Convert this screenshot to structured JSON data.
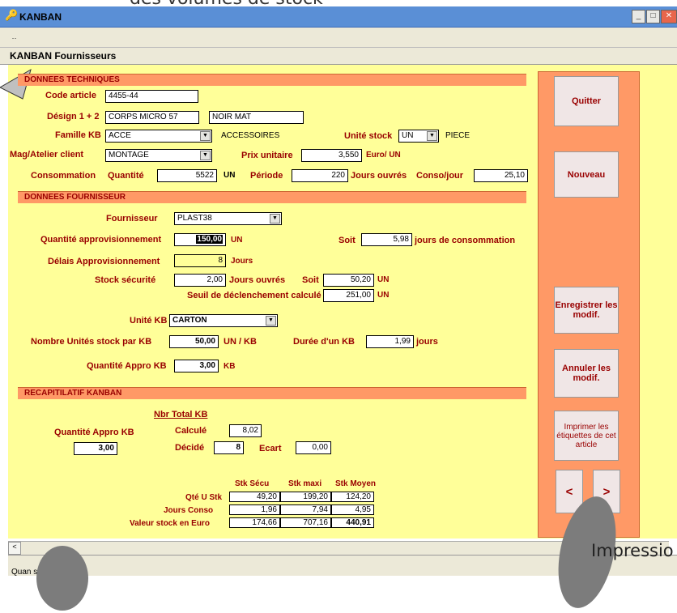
{
  "background": {
    "text": "des volumes de stock"
  },
  "window": {
    "title": "KANBAN",
    "form_title": "KANBAN Fournisseurs",
    "menu": " ․․"
  },
  "sections": {
    "tech": "DONNEES TECHNIQUES",
    "fourn": "DONNEES FOURNISSEUR",
    "recap": "RECAPITILATIF KANBAN"
  },
  "tech": {
    "code_label": "Code article",
    "code": "4455-44",
    "desig_label": "Désign 1 + 2",
    "desig1": "CORPS MICRO 57",
    "desig2": "NOIR MAT",
    "famille_label": "Famille KB",
    "famille": "ACCE",
    "famille_desc": "ACCESSOIRES",
    "unite_label": "Unité stock",
    "unite": "UN",
    "unite_desc": "PIECE",
    "mag_label": "Mag/Atelier client",
    "mag": "MONTAGE",
    "prix_label": "Prix unitaire",
    "prix": "3,550",
    "prix_unit": "Euro/ UN",
    "conso_label": "Consommation",
    "qte_label": "Quantité",
    "qte": "5522",
    "qte_unit": "UN",
    "periode_label": "Période",
    "periode": "220",
    "periode_unit": "Jours ouvrés",
    "consojour_label": "Conso/jour",
    "consojour": "25,10"
  },
  "fourn": {
    "fournisseur_label": "Fournisseur",
    "fournisseur": "PLAST38",
    "qa_label": "Quantité approvisionnement",
    "qa": "150,00",
    "qa_unit": "UN",
    "soit_label": "Soit",
    "soit": "5,98",
    "soit_unit": "jours de consommation",
    "delai_label": "Délais Approvisionnement",
    "delai": "8",
    "delai_unit": "Jours",
    "secu_label": "Stock sécurité",
    "secu": "2,00",
    "secu_unit": "Jours ouvrés",
    "secu_soit": "Soit",
    "secu_un": "50,20",
    "secu_un_unit": "UN",
    "seuil_label": "Seuil de déclenchement calculé",
    "seuil": "251,00",
    "seuil_unit": "UN",
    "unitekb_label": "Unité KB",
    "unitekb": "CARTON",
    "nbunit_label": "Nombre Unités stock par KB",
    "nbunit": "50,00",
    "nbunit_unit": "UN / KB",
    "duree_label": "Durée d'un KB",
    "duree": "1,99",
    "duree_unit": "jours",
    "qtekb_label": "Quantité Appro KB",
    "qtekb": "3,00",
    "qtekb_unit": "KB"
  },
  "recap": {
    "nbr_label": "Nbr Total KB",
    "qte_label": "Quantité Appro KB",
    "qte": "3,00",
    "calc_label": "Calculé",
    "calc": "8,02",
    "decide_label": "Décidé",
    "decide": "8",
    "ecart_label": "Ecart",
    "ecart": "0,00",
    "cols": [
      "Stk Sécu",
      "Stk maxi",
      "Stk Moyen"
    ],
    "rows": [
      {
        "label": "Qté U Stk",
        "values": [
          "49,20",
          "199,20",
          "124,20"
        ]
      },
      {
        "label": "Jours Conso",
        "values": [
          "1,96",
          "7,94",
          "4,95"
        ]
      },
      {
        "label": "Valeur stock en Euro",
        "values": [
          "174,66",
          "707,16",
          "440,91"
        ]
      }
    ]
  },
  "buttons": {
    "quitter": "Quitter",
    "nouveau": "Nouveau",
    "enregistrer": "Enregistrer les modif.",
    "annuler": "Annuler les modif.",
    "imprimer": "Imprimer les étiquettes de cet article",
    "prev": "<",
    "next": ">"
  },
  "status": {
    "text": "Quan     sionnement",
    "impression": "Impressio"
  },
  "colors": {
    "section": "#ff9966",
    "form": "#ffff99",
    "label": "#990000"
  }
}
